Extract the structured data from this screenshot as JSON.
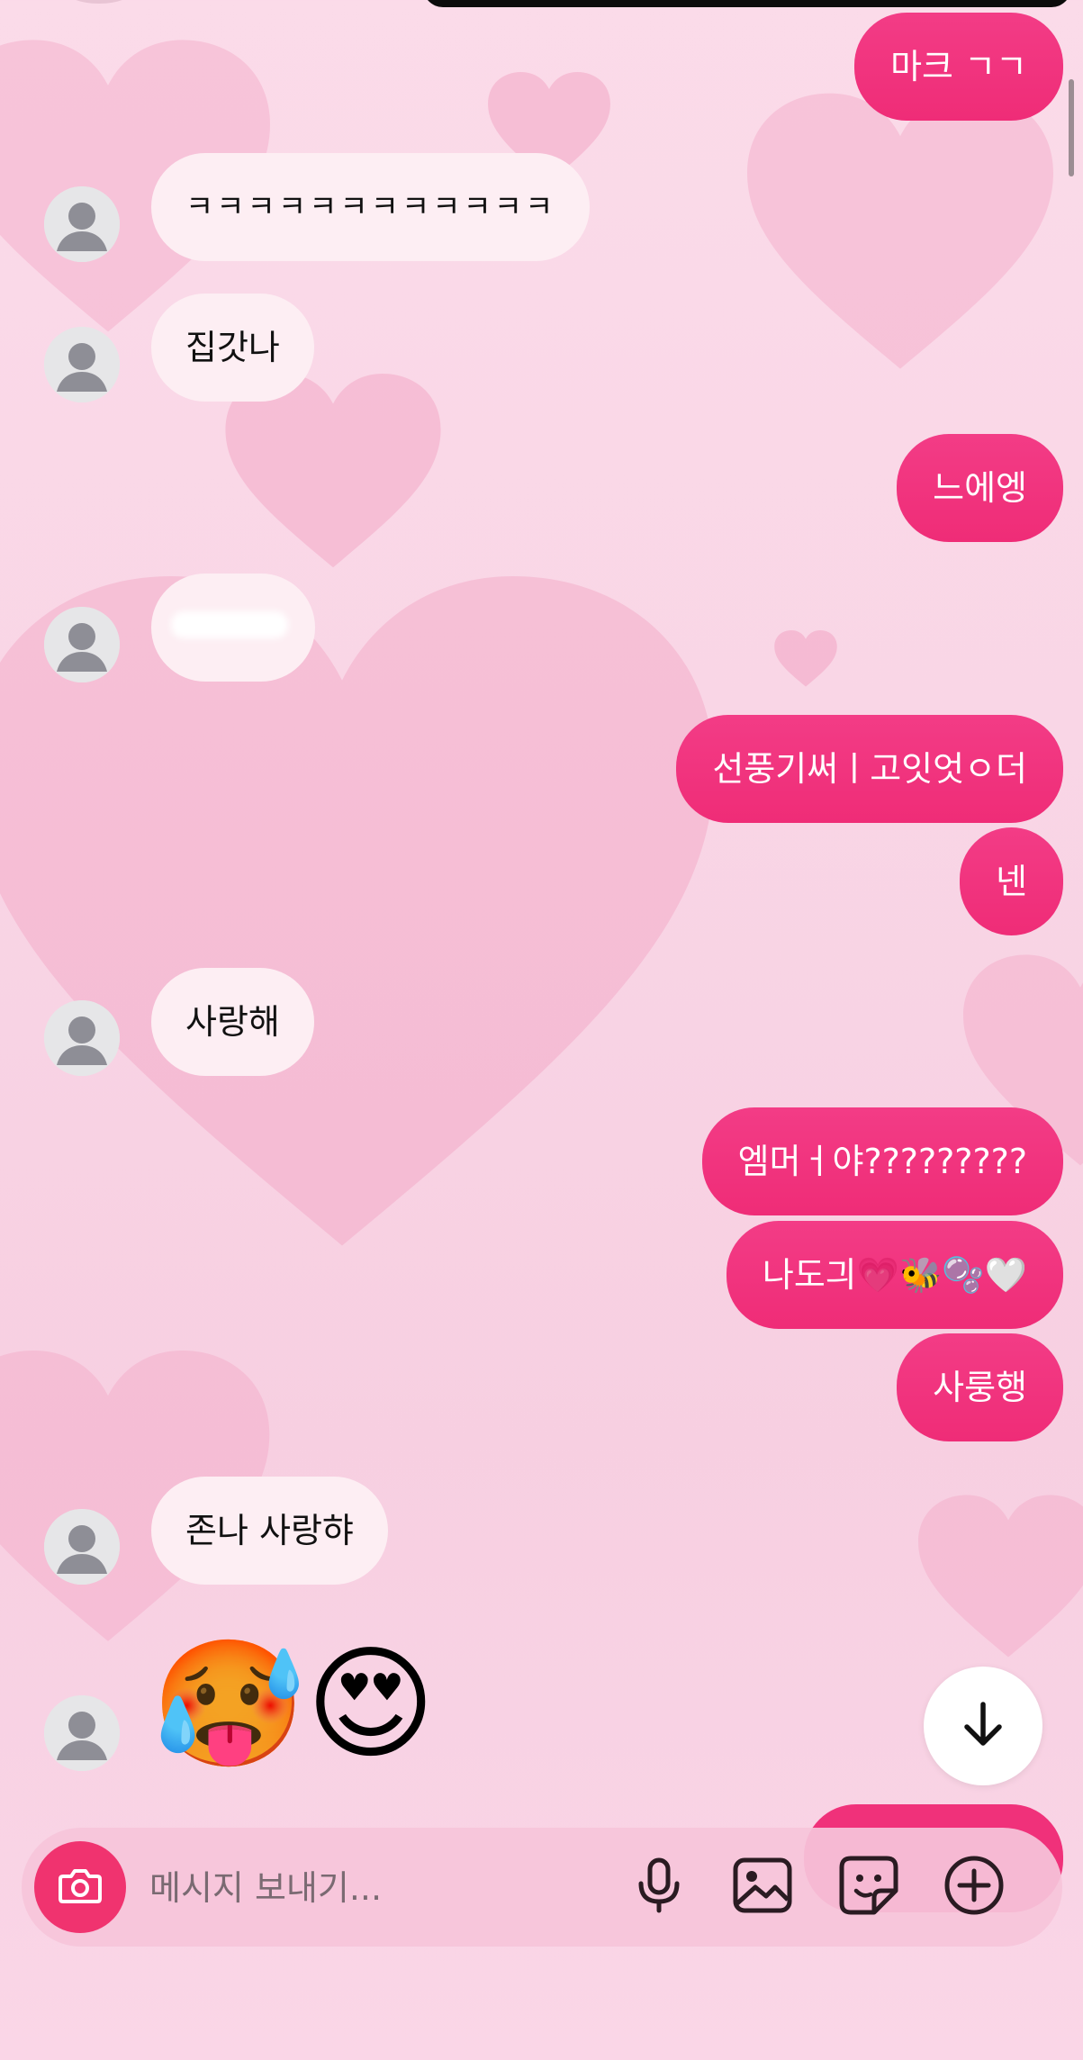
{
  "colors": {
    "outgoing_bubble": "#f0317a",
    "incoming_bubble": "#fdeef3",
    "camera_button": "#f0336f",
    "background": "#f9d6e6"
  },
  "messages": [
    {
      "side": "out",
      "text": "마크 ㄱㄱ"
    },
    {
      "side": "in",
      "text": "ㅋㅋㅋㅋㅋㅋㅋㅋㅋㅋㅋㅋ"
    },
    {
      "side": "in",
      "text": "집갓나"
    },
    {
      "side": "out",
      "text": "느에엥"
    },
    {
      "side": "in",
      "text": ""
    },
    {
      "side": "out",
      "text": "선풍기써ㅣ고잇엇ㅇ더"
    },
    {
      "side": "out",
      "text": "넨"
    },
    {
      "side": "in",
      "text": "사랑해"
    },
    {
      "side": "out",
      "text": "엠머ㅓ야?????????"
    },
    {
      "side": "out",
      "text": "나도긔💗🐝🫧🤍"
    },
    {
      "side": "out",
      "text": "사룽행"
    },
    {
      "side": "in",
      "text": "존나 사랑햐"
    },
    {
      "side": "in",
      "text": "🥵😍"
    }
  ],
  "composer": {
    "placeholder": "메시지 보내기..."
  },
  "icons": {
    "camera": "camera-icon",
    "mic": "microphone-icon",
    "gallery": "image-icon",
    "sticker": "sticker-icon",
    "add": "plus-circle-icon",
    "scroll_down": "arrow-down-icon"
  }
}
